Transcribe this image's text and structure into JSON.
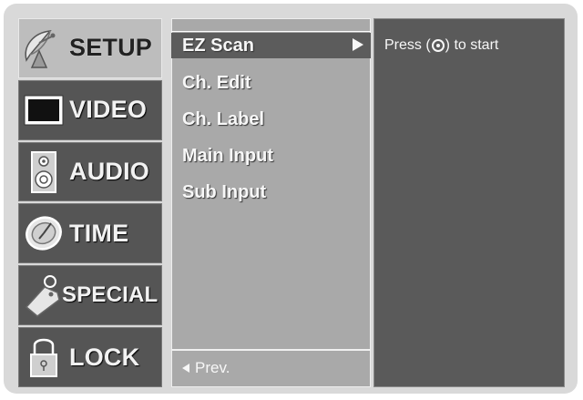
{
  "sidebar": {
    "items": [
      {
        "label": "SETUP",
        "icon": "satellite-dish-icon",
        "active": true
      },
      {
        "label": "VIDEO",
        "icon": "tv-screen-icon",
        "active": false
      },
      {
        "label": "AUDIO",
        "icon": "speaker-icon",
        "active": false
      },
      {
        "label": "TIME",
        "icon": "clock-icon",
        "active": false
      },
      {
        "label": "SPECIAL",
        "icon": "key-tag-icon",
        "active": false
      },
      {
        "label": "LOCK",
        "icon": "padlock-icon",
        "active": false
      }
    ]
  },
  "menu": {
    "items": [
      {
        "label": "EZ Scan",
        "selected": true
      },
      {
        "label": "Ch. Edit",
        "selected": false
      },
      {
        "label": "Ch. Label",
        "selected": false
      },
      {
        "label": "Main Input",
        "selected": false
      },
      {
        "label": "Sub Input",
        "selected": false
      }
    ],
    "prev_label": "Prev."
  },
  "panel": {
    "hint_prefix": "Press (",
    "hint_suffix": ") to start",
    "hint_icon": "ok-button-icon"
  },
  "colors": {
    "frame": "#d9d9d9",
    "sidebar_item": "#555555",
    "sidebar_active": "#bdbdbd",
    "menu_bg": "#a9a9a9",
    "menu_selected": "#5c5c5c",
    "panel_bg": "#5a5a5a",
    "text_light": "#f7f7f7"
  }
}
